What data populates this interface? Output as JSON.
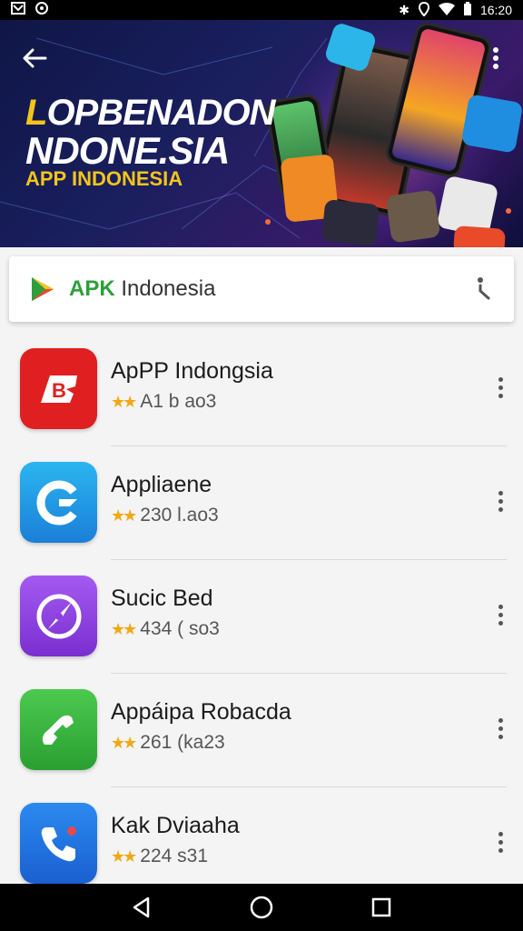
{
  "status_bar": {
    "time": "16:20",
    "left_icons": [
      "notification-icon",
      "sync-icon"
    ],
    "right_icons": [
      "bluetooth-icon",
      "location-icon",
      "wifi-icon",
      "battery-icon"
    ]
  },
  "hero": {
    "title_first_letter": "L",
    "title_line1": "OPBENADON",
    "title_line2": "NDONE.SIA",
    "subtitle": "APP INDONESIA",
    "colors": {
      "bg": "#1a1f5e",
      "accent": "#f3c51b"
    }
  },
  "search_card": {
    "brand_bold": "APK",
    "brand_rest": " Indonesia",
    "mic_icon": "mic-icon"
  },
  "apps": [
    {
      "name": "ApPP Indongsia",
      "meta": "A1 b ao3",
      "icon": "red-b-icon",
      "color": "#e02020"
    },
    {
      "name": "Appliaene",
      "meta": "230 l.ao3",
      "icon": "blue-c-icon",
      "color": "#1e9be8"
    },
    {
      "name": "Sucic Bed",
      "meta": "434 ( so3",
      "icon": "purple-compass-icon",
      "color": "#8e3fe0"
    },
    {
      "name": "Appáipa Robacda",
      "meta": "261 (ka23",
      "icon": "green-phone-icon",
      "color": "#35b23a"
    },
    {
      "name": "Kak Dviaaha",
      "meta": "224 s31",
      "icon": "blue-phone-icon",
      "color": "#1a74e0"
    }
  ],
  "nav": {
    "back": "back-triangle-icon",
    "home": "home-circle-icon",
    "recents": "recents-square-icon"
  }
}
